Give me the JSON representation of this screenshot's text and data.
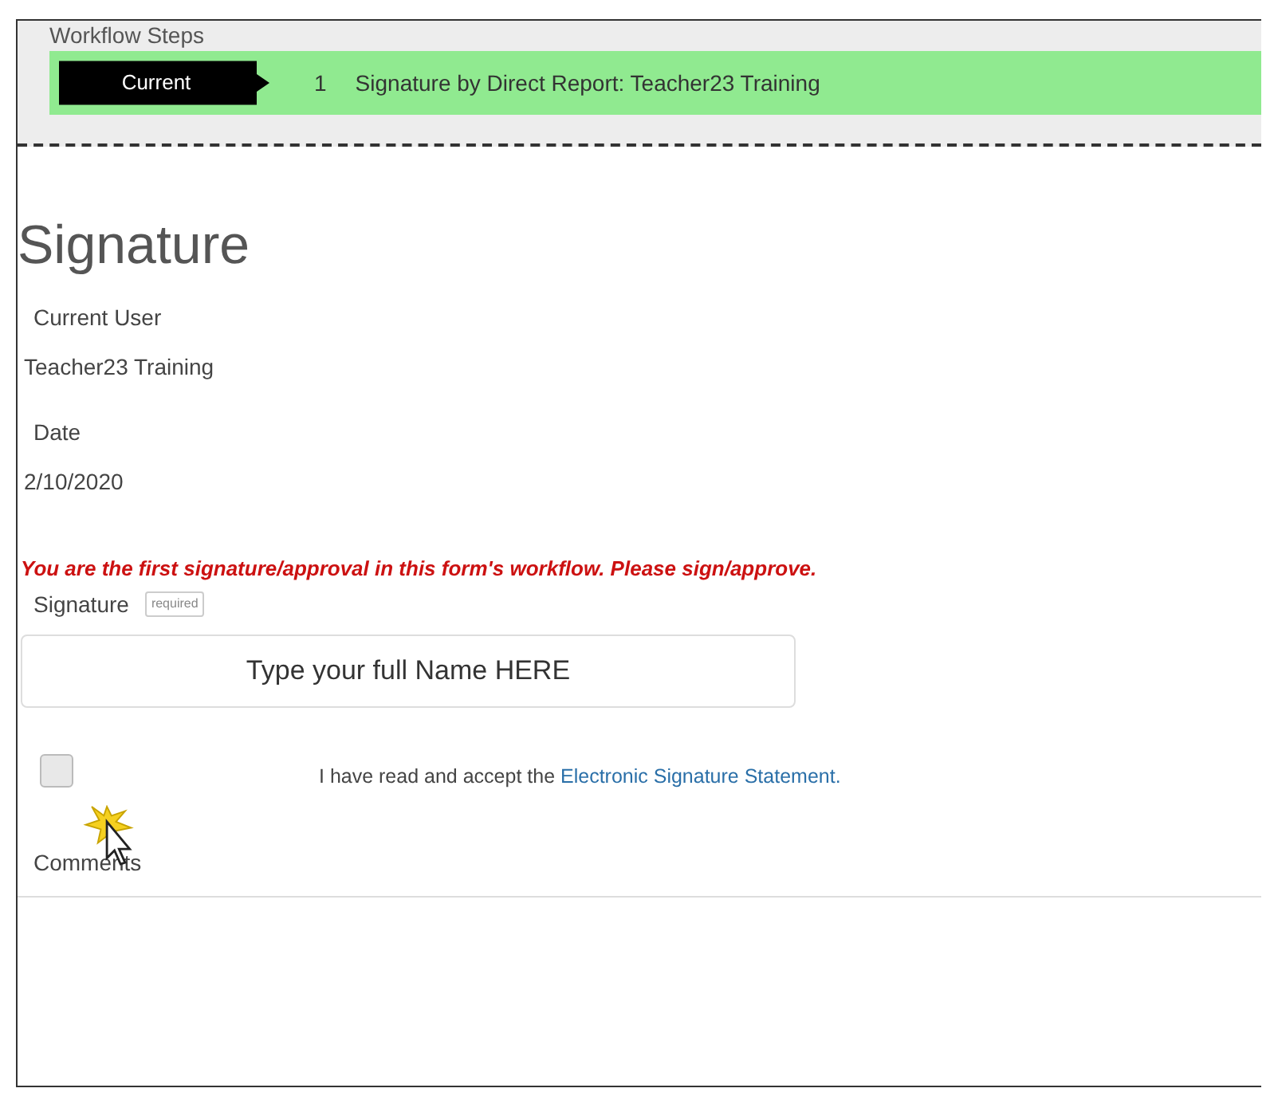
{
  "workflow": {
    "heading": "Workflow Steps",
    "steps": [
      {
        "status": "Current",
        "number": "1",
        "name": "Signature by Direct Report: Teacher23 Training"
      }
    ]
  },
  "section": {
    "title": "Signature",
    "fields": [
      {
        "label": "Current User",
        "value": "Teacher23 Training"
      },
      {
        "label": "Date",
        "value": "2/10/2020"
      }
    ],
    "notice": "You are the first signature/approval in this form's workflow. Please sign/approve.",
    "signature": {
      "label": "Signature",
      "badge": "required",
      "value": "Type your full Name HERE"
    },
    "agreement": {
      "checked": false,
      "text": "I have read and accept the",
      "link": "Electronic Signature Statement."
    },
    "comments_label": "Comments"
  }
}
